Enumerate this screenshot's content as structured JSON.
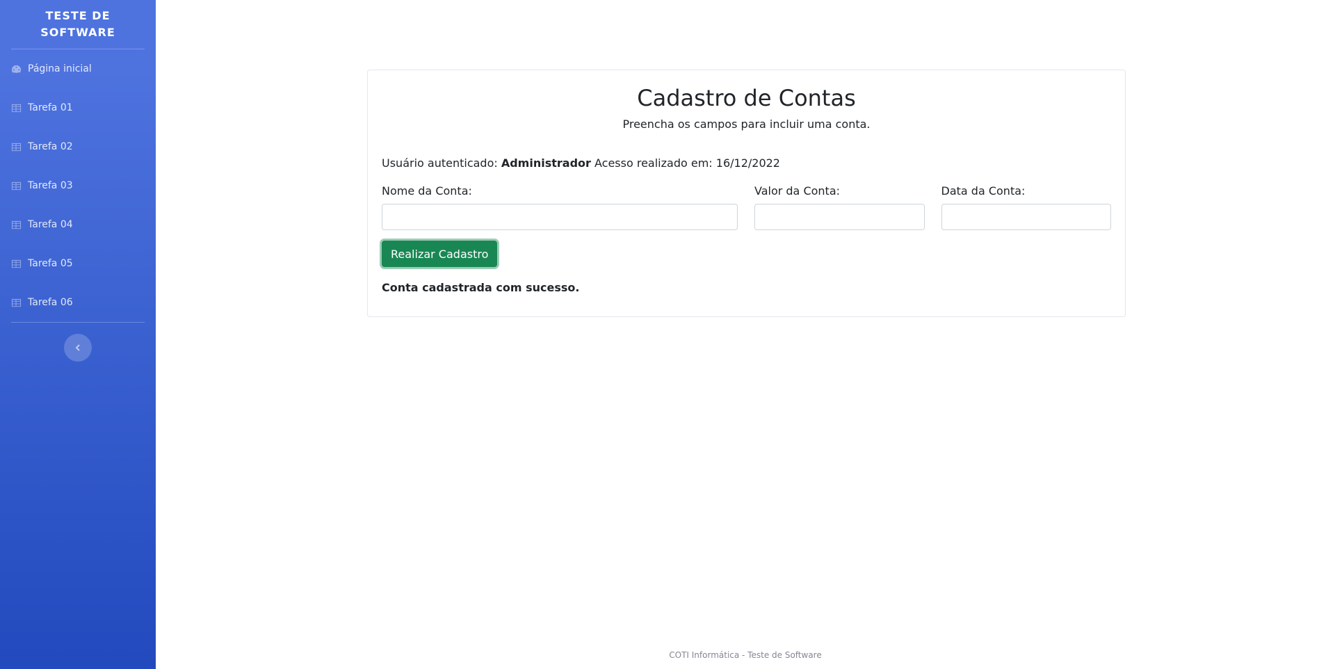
{
  "sidebar": {
    "brand": "TESTE DE SOFTWARE",
    "items": [
      {
        "label": "Página inicial",
        "icon": "tachometer-icon"
      },
      {
        "label": "Tarefa 01",
        "icon": "table-icon"
      },
      {
        "label": "Tarefa 02",
        "icon": "table-icon"
      },
      {
        "label": "Tarefa 03",
        "icon": "table-icon"
      },
      {
        "label": "Tarefa 04",
        "icon": "table-icon"
      },
      {
        "label": "Tarefa 05",
        "icon": "table-icon"
      },
      {
        "label": "Tarefa 06",
        "icon": "table-icon"
      }
    ],
    "toggle_icon": "chevron-left-icon"
  },
  "form": {
    "title": "Cadastro de Contas",
    "subtitle": "Preencha os campos para incluir uma conta.",
    "auth_prefix": "Usuário autenticado:",
    "auth_user": "Administrador",
    "access_prefix": "Acesso realizado em:",
    "access_date": "16/12/2022",
    "fields": {
      "nome_label": "Nome da Conta:",
      "nome_value": "",
      "valor_label": "Valor da Conta:",
      "valor_value": "",
      "data_label": "Data da Conta:",
      "data_value": ""
    },
    "submit_label": "Realizar Cadastro",
    "message": "Conta cadastrada com sucesso."
  },
  "footer": {
    "text": "COTI Informática - Teste de Software"
  },
  "colors": {
    "sidebar_top": "#4e73df",
    "sidebar_bottom": "#224abe",
    "success": "#198754"
  }
}
